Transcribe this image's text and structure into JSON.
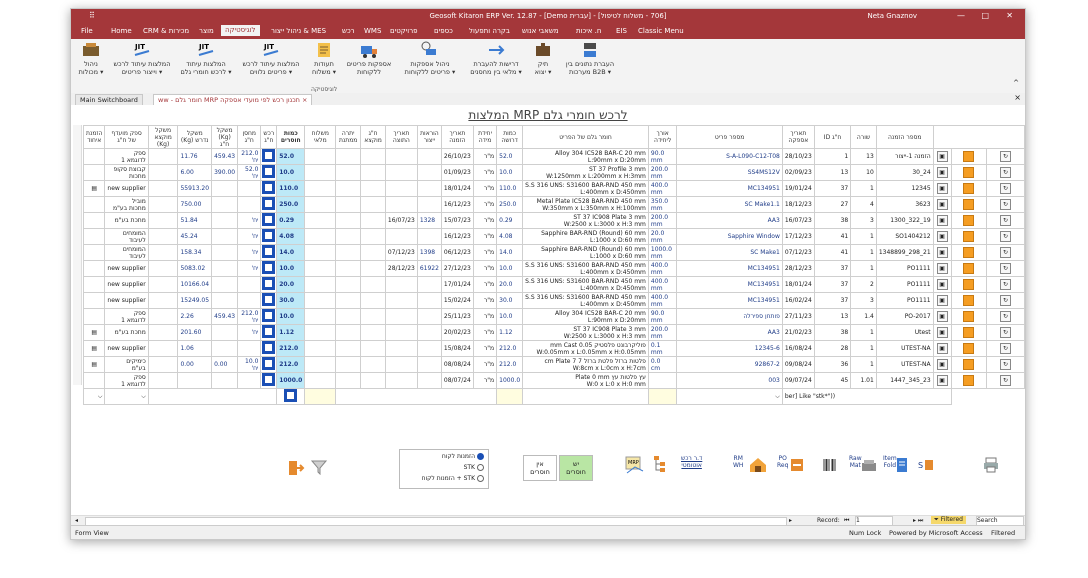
{
  "window": {
    "title": "Geosoft Kitaron ERP Ver. 12.87 - [Demo עברית] - [706 - משלוח לטיפול]",
    "user": "Neta Gnaznov",
    "minimize": "—",
    "restore": "□",
    "close": "✕"
  },
  "menu": [
    "File",
    "Home",
    "CRM & מכירות",
    "מוצר",
    "לוגיסטיקה",
    "ניהול ייצור & MES",
    "רכש",
    "WMS",
    "פרויקטים",
    "כספים",
    "בקרה ותפעול",
    "משאבי אנוש",
    "ח. איכות",
    "EIS",
    "Classic Menu"
  ],
  "active_menu": "לוגיסטיקה",
  "ribbon": {
    "buttons": [
      {
        "label": "ניהול\nמכולות ▾",
        "icon": "containers-icon"
      },
      {
        "label": "המלצות עיתוד לרכש\nוייצור פריטים ▾",
        "icon": "jit-icon"
      },
      {
        "label": "המלצות עיתוד\nלרכש חומרי גלם ▾",
        "icon": "jit-icon"
      },
      {
        "label": "המלצות עיתוד לרכש\nפריטים נלווים ▾",
        "icon": "jit-icon"
      },
      {
        "label": "תעודות\nמשלוח ▾",
        "icon": "delivery-note-icon"
      },
      {
        "label": "אספקות פריטים\nללקוחות",
        "icon": "truck-icon"
      },
      {
        "label": "ניהול אספקות\nפריטים ללקוחות ▾",
        "icon": "truck-clock-icon"
      },
      {
        "label": "דרישות להעברת\nמלאי בין מחסנים ▾",
        "icon": "transfer-icon"
      },
      {
        "label": "תיק\nיצוא ▾",
        "icon": "export-icon"
      },
      {
        "label": "העברת נתונים בין\nמערכות B2B ▾",
        "icon": "b2b-icon"
      }
    ],
    "group_label": "לוגיסטיקה"
  },
  "tabs": [
    {
      "label": "Main Switchboard"
    },
    {
      "label": "ww - חומר גלם MRP תכנון רכש לפי מועדי אספקה"
    }
  ],
  "form_title": "המלצות MRP לרכש חומרי גלם",
  "columns": [
    "מספר הזמנה",
    "שורה",
    "ח\"ג ID",
    "תאריך אספקה",
    "מספר פריט",
    "אורך ליחידה",
    "חומר גלם של הפריט",
    "כמות דרושה",
    "יחידת מידה",
    "תאריך הזמנה",
    "הוראות ייצור",
    "תאריך התוצה",
    "ח\"ג מוקצא",
    "יתרה ממתנת",
    "משלוח מלאי",
    "כמות חוסרים",
    "רכש ח\"ג",
    "מחסן ח\"ג",
    "משקל (Kg) ח\"ג",
    "משקל נדרש (Kg)",
    "משקל מוקצא (Kg)",
    "ספק מועדף של ח\"ג",
    "הזמנת איחוד"
  ],
  "rows": [
    {
      "order": "הזמנה 1-ייצור",
      "line": "13",
      "mid": "1",
      "supply": "28/10/23",
      "item": "S-A-L090-C12-T08",
      "len": "90.0\nmm",
      "desc": "Alloy 304 IC528 BAR-C 20 mm\nL:90mm x D:20mm",
      "qty": "52.0",
      "uom": "מ\"ר",
      "odate": "26/10/23",
      "prod": "",
      "due": "",
      "alloc": "",
      "bal": "",
      "ship": "",
      "short": "52.0",
      "wh": "212.0\nיח'",
      "wkg": "459.43",
      "need": "11.76",
      "allockg": "",
      "supplier": "ספק\nלדוגמא 1",
      "consol": ""
    },
    {
      "order": "24_30",
      "line": "10",
      "mid": "13",
      "supply": "02/09/23",
      "item": "SS4MS12V",
      "len": "200.0\nmm",
      "desc": "ST 37 Profile 3 mm\nW:1250mm x L:200mm x H:3mm",
      "qty": "10.0",
      "uom": "מ\"ר",
      "odate": "01/09/23",
      "prod": "",
      "due": "",
      "alloc": "",
      "bal": "",
      "ship": "",
      "short": "10.0",
      "wh": "52.0\nיח'",
      "wkg": "390.00",
      "need": "6.00",
      "allockg": "",
      "supplier": "קבוצת סקופ\nמתכות",
      "consol": ""
    },
    {
      "order": "12345",
      "line": "1",
      "mid": "37",
      "supply": "19/01/24",
      "item": "MC134951",
      "len": "400.0\nmm",
      "desc": "S.S 316 UNS: S31600 BAR-RND 450 mm\nL:400mm x D:450mm",
      "qty": "110.0",
      "uom": "מ\"ר",
      "odate": "18/01/24",
      "prod": "",
      "due": "",
      "alloc": "",
      "bal": "",
      "ship": "",
      "short": "110.0",
      "wh": "",
      "wkg": "",
      "need": "55913.20",
      "allockg": "",
      "supplier": "new supplier",
      "consol": "doc"
    },
    {
      "order": "3623",
      "line": "4",
      "mid": "27",
      "supply": "18/12/23",
      "item": "SC Make1.1",
      "len": "350.0\nmm",
      "desc": "Metal Plate IC528 BAR-RND 450 mm\nW:350mm x L:350mm x H:100mm",
      "qty": "250.0",
      "uom": "מ\"ר",
      "odate": "16/12/23",
      "prod": "",
      "due": "",
      "alloc": "",
      "bal": "",
      "ship": "",
      "short": "250.0",
      "wh": "",
      "wkg": "",
      "need": "750.00",
      "allockg": "",
      "supplier": "מוביל\nמתכות בע\"מ",
      "consol": ""
    },
    {
      "order": "19_322_1300",
      "line": "3",
      "mid": "38",
      "supply": "16/07/23",
      "item": "AA3",
      "len": "200.0\nmm",
      "desc": "ST 37 IC908 Plate 3 mm\nW:2500 x L:3000 x H:3 mm",
      "qty": "0.29",
      "uom": "מ\"ר",
      "odate": "15/07/23",
      "prod": "1328",
      "due": "16/07/23",
      "alloc": "",
      "bal": "",
      "ship": "",
      "short": "0.29",
      "wh": "יח'",
      "wkg": "",
      "need": "51.84",
      "allockg": "",
      "supplier": "מתכת בע\"מ",
      "consol": ""
    },
    {
      "order": "SO1404212",
      "line": "1",
      "mid": "41",
      "supply": "17/12/23",
      "item": "Sapphire Window",
      "len": "20.0\nmm",
      "desc": "Sapphire BAR-RND (Round) 60 mm\nL:1000 x D:60 mm",
      "qty": "4.08",
      "uom": "מ\"ר",
      "odate": "16/12/23",
      "prod": "",
      "due": "",
      "alloc": "",
      "bal": "",
      "ship": "",
      "short": "4.08",
      "wh": "יח'",
      "wkg": "",
      "need": "45.24",
      "allockg": "",
      "supplier": "המומחים\nלעיבוד",
      "consol": ""
    },
    {
      "order": "21_298_1348899",
      "line": "1",
      "mid": "41",
      "supply": "07/12/23",
      "item": "SC Make1",
      "len": "1000.0\nmm",
      "desc": "Sapphire BAR-RND (Round) 60 mm\nL:1000 x D:60 mm",
      "qty": "14.0",
      "uom": "מ\"ר",
      "odate": "06/12/23",
      "prod": "1398",
      "due": "07/12/23",
      "alloc": "",
      "bal": "",
      "ship": "",
      "short": "14.0",
      "wh": "יח'",
      "wkg": "",
      "need": "158.34",
      "allockg": "",
      "supplier": "המומחים\nלעיבוד",
      "consol": ""
    },
    {
      "order": "PO1111",
      "line": "1",
      "mid": "37",
      "supply": "28/12/23",
      "item": "MC134951",
      "len": "400.0\nmm",
      "desc": "S.S 316 UNS: S31600 BAR-RND 450 mm\nL:400mm x D:450mm",
      "qty": "10.0",
      "uom": "מ\"ר",
      "odate": "27/12/23",
      "prod": "61922",
      "due": "28/12/23",
      "alloc": "",
      "bal": "",
      "ship": "",
      "short": "10.0",
      "wh": "יח'",
      "wkg": "",
      "need": "5083.02",
      "allockg": "",
      "supplier": "new supplier",
      "consol": ""
    },
    {
      "order": "PO1111",
      "line": "2",
      "mid": "37",
      "supply": "18/01/24",
      "item": "MC134951",
      "len": "400.0\nmm",
      "desc": "S.S 316 UNS: S31600 BAR-RND 450 mm\nL:400mm x D:450mm",
      "qty": "20.0",
      "uom": "מ\"ר",
      "odate": "17/01/24",
      "prod": "",
      "due": "",
      "alloc": "",
      "bal": "",
      "ship": "",
      "short": "20.0",
      "wh": "",
      "wkg": "",
      "need": "10166.04",
      "allockg": "",
      "supplier": "new supplier",
      "consol": ""
    },
    {
      "order": "PO1111",
      "line": "3",
      "mid": "37",
      "supply": "16/02/24",
      "item": "MC134951",
      "len": "400.0\nmm",
      "desc": "S.S 316 UNS: S31600 BAR-RND 450 mm\nL:400mm x D:450mm",
      "qty": "30.0",
      "uom": "מ\"ר",
      "odate": "15/02/24",
      "prod": "",
      "due": "",
      "alloc": "",
      "bal": "",
      "ship": "",
      "short": "30.0",
      "wh": "",
      "wkg": "",
      "need": "15249.05",
      "allockg": "",
      "supplier": "new supplier",
      "consol": ""
    },
    {
      "order": "PO-2017",
      "line": "1.4",
      "mid": "13",
      "supply": "27/11/23",
      "item": "פותחן ספירלה",
      "len": "90.0\nmm",
      "desc": "Alloy 304 IC528 BAR-C 20 mm\nL:90mm x D:20mm",
      "qty": "10.0",
      "uom": "מ\"ר",
      "odate": "25/11/23",
      "prod": "",
      "due": "",
      "alloc": "",
      "bal": "",
      "ship": "",
      "short": "10.0",
      "wh": "212.0\nיח'",
      "wkg": "459.43",
      "need": "2.26",
      "allockg": "",
      "supplier": "ספק\nלדוגמא 1",
      "consol": ""
    },
    {
      "order": "Utest",
      "line": "1",
      "mid": "38",
      "supply": "21/02/23",
      "item": "AA3",
      "len": "200.0\nmm",
      "desc": "ST 37 IC908 Plate 3 mm\nW:2500 x L:3000 x H:3 mm",
      "qty": "1.12",
      "uom": "מ\"ר",
      "odate": "20/02/23",
      "prod": "",
      "due": "",
      "alloc": "",
      "bal": "",
      "ship": "",
      "short": "1.12",
      "wh": "יח'",
      "wkg": "",
      "need": "201.60",
      "allockg": "",
      "supplier": "מתכת בע\"מ",
      "consol": "doc"
    },
    {
      "order": "UTEST-NA",
      "line": "1",
      "mid": "28",
      "supply": "16/08/24",
      "item": "12345-6",
      "len": "0.1\nmm",
      "desc": "פוליקרבונט פלסטיק 0.05 mm Cast\nW:0.05mm x L:0.05mm x H:0.05mm",
      "qty": "212.0",
      "uom": "מ\"ר",
      "odate": "15/08/24",
      "prod": "",
      "due": "",
      "alloc": "",
      "bal": "",
      "ship": "",
      "short": "212.0",
      "wh": "",
      "wkg": "",
      "need": "1.06",
      "allockg": "",
      "supplier": "new supplier",
      "consol": "doc"
    },
    {
      "order": "UTEST-NA",
      "line": "1",
      "mid": "36",
      "supply": "09/08/24",
      "item": "92867-2",
      "len": "0.0\ncm",
      "desc": "פלטות ברזל פלטת ברזל 7 cm Plate 7\nW:8cm x L:0cm x H:7cm",
      "qty": "212.0",
      "uom": "מ\"ר",
      "odate": "08/08/24",
      "prod": "",
      "due": "",
      "alloc": "",
      "bal": "",
      "ship": "",
      "short": "212.0",
      "wh": "10.0\nיח'",
      "wkg": "0.00",
      "need": "0.00",
      "allockg": "",
      "supplier": "כימיקים\nבע\"מ",
      "consol": "doc"
    },
    {
      "order": "23_345_1447",
      "line": "1.01",
      "mid": "45",
      "supply": "09/07/24",
      "item": "003",
      "len": "",
      "desc": "עץ פלטות עץ Plate 0 mm\nW:0 x L:0 x H:0 mm",
      "qty": "1000.0",
      "uom": "מ\"ר",
      "odate": "08/07/24",
      "prod": "",
      "due": "",
      "alloc": "",
      "bal": "",
      "ship": "",
      "short": "1000.0",
      "wh": "",
      "wkg": "",
      "need": "",
      "allockg": "",
      "supplier": "ספק\nלדוגמא 1",
      "consol": ""
    }
  ],
  "filter_text": "ber] Like \"stk*\"))",
  "radio": {
    "options": [
      "הזמנות לקוח",
      "STK",
      "הזמנות לקוח + STK"
    ],
    "selected": 0
  },
  "buttons": {
    "no_shortage": "אין\nחוסרים",
    "has_shortage": "יש\nחוסרים",
    "mrp_report": "ד.ר רכש\nאוטומטי",
    "rm_wh": "RM\nWH",
    "po_req": "PO\nReq",
    "raw_mat": "Raw\nMat",
    "item_fold": "Item\nFold",
    "print": "Print"
  },
  "nav": {
    "record_label": "Record:",
    "record": "1",
    "filtered": "Filtered",
    "search": "Search"
  },
  "status": {
    "left": "Form View",
    "numlock": "Num Lock",
    "powered": "Powered by Microsoft Access",
    "filtered": "Filtered"
  },
  "colors": {
    "accent": "#a4373a",
    "shortage_bg": "#bde9f7",
    "link_blue": "#1f3c88"
  }
}
